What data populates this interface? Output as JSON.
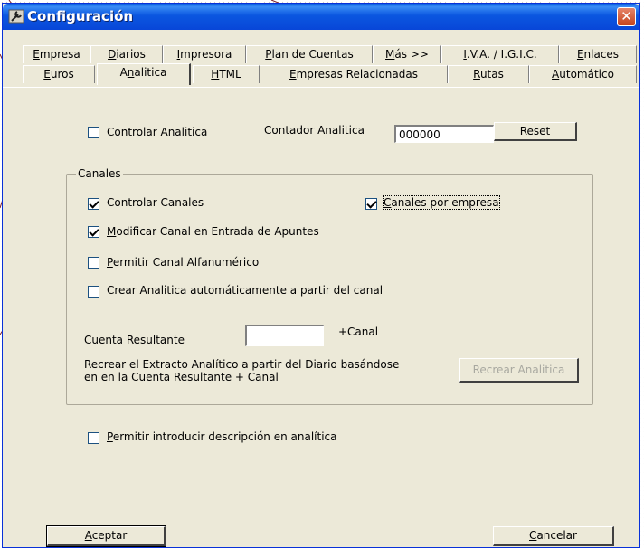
{
  "window": {
    "title": "Configuración",
    "close_symbol": "✕",
    "colors": {
      "titlebar": "#0b57e0",
      "face": "#ece9d8",
      "close": "#c4431d"
    }
  },
  "tabs": {
    "row1": [
      {
        "pre": "",
        "ul": "E",
        "post": "mpresa"
      },
      {
        "pre": "",
        "ul": "D",
        "post": "iarios"
      },
      {
        "pre": "",
        "ul": "I",
        "post": "mpresora"
      },
      {
        "pre": "",
        "ul": "P",
        "post": "lan de Cuentas"
      },
      {
        "pre": "",
        "ul": "M",
        "post": "ás >>"
      },
      {
        "pre": "",
        "ul": "I",
        "post": ".V.A. / I.G.I.C."
      },
      {
        "pre": "",
        "ul": "E",
        "post": "nlaces"
      }
    ],
    "row2": [
      {
        "pre": "",
        "ul": "E",
        "post": "uros"
      },
      {
        "pre": "A",
        "ul": "n",
        "post": "alitica"
      },
      {
        "pre": "",
        "ul": "H",
        "post": "TML"
      },
      {
        "pre": "",
        "ul": "E",
        "post": "mpresas Relacionadas"
      },
      {
        "pre": "",
        "ul": "R",
        "post": "utas"
      },
      {
        "pre": "",
        "ul": "A",
        "post": "utomático"
      }
    ],
    "active": "Analitica"
  },
  "controlar_analitica": {
    "ul": "C",
    "post": "ontrolar Analitica",
    "checked": false
  },
  "contador": {
    "label": "Contador Analitica",
    "value": "000000",
    "reset_label": "Reset"
  },
  "canales": {
    "legend": "Canales",
    "controlar_canales": {
      "ul": "",
      "text": "Controlar Canales",
      "checked": true
    },
    "canales_por_empresa": {
      "ul": "C",
      "post": "anales por empresa",
      "checked": true
    },
    "modificar_canal": {
      "ul": "M",
      "post": "odificar Canal en Entrada de Apuntes",
      "checked": true
    },
    "permitir_alfanumerico": {
      "ul": "P",
      "post": "ermitir Canal Alfanumérico",
      "checked": false
    },
    "crear_analitica": {
      "text": "Crear Analitica automáticamente a partir del canal",
      "checked": false
    },
    "cuenta_resultante": {
      "label": "Cuenta Resultante",
      "value": "",
      "suffix": "+Canal"
    },
    "recrear_text_1": "Recrear el Extracto Analítico a partir del Diario basándose",
    "recrear_text_2": "en en la Cuenta Resultante + Canal",
    "recrear_button": "Recrear Analitica"
  },
  "permitir_descripcion": {
    "ul": "P",
    "post": "ermitir introducir descripción en analítica",
    "checked": false
  },
  "footer": {
    "aceptar": {
      "ul": "A",
      "post": "ceptar"
    },
    "cancelar": {
      "ul": "C",
      "post": "ancelar"
    }
  }
}
